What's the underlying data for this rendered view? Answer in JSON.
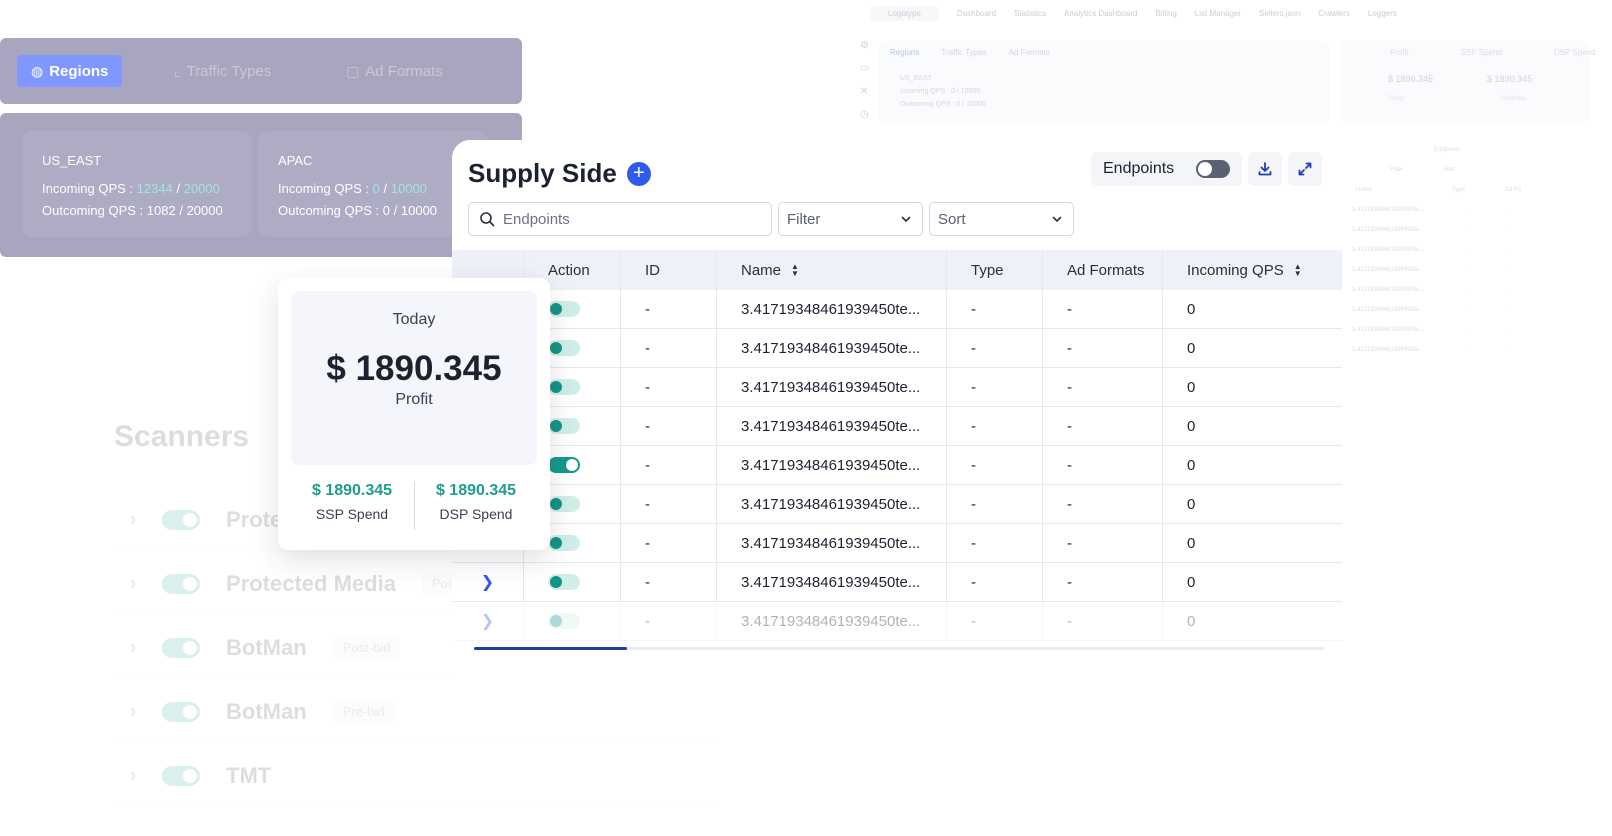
{
  "background_dashboard": {
    "nav": [
      "Logotype",
      "Dashboard",
      "Statistics",
      "Analytics Dashboard",
      "Billing",
      "List Manager",
      "Sellers.json",
      "Crawlers",
      "Loggers"
    ],
    "tabs": [
      "Regions",
      "Traffic Types",
      "Ad Formats"
    ],
    "region": "US_EAST",
    "incoming": "Incoming QPS : 0 / 10000",
    "outcoming": "Outcoming QPS : 0 / 10000",
    "profit_tabs": [
      "Profit",
      "SSP Spend",
      "DSP Spend"
    ],
    "profit_values": [
      "$ 1890.345",
      "$ 1890.345"
    ],
    "profit_sub": [
      "Today",
      "Yesterday"
    ],
    "table_toolbar": {
      "toggle": "Endpoints",
      "filter": "Filter",
      "sort": "Sort"
    },
    "table_headers": [
      "ID",
      "Name",
      "Type",
      "Ad Fo"
    ],
    "table_rows": [
      {
        "id": "-",
        "name": "3.41719348461939450te...",
        "type": "-",
        "ad": "-"
      },
      {
        "id": "-",
        "name": "3.41719348461939450te...",
        "type": "-",
        "ad": "-"
      },
      {
        "id": "-",
        "name": "3.41719348461939450te...",
        "type": "-",
        "ad": "-"
      },
      {
        "id": "-",
        "name": "3.41719348461939450te...",
        "type": "-",
        "ad": "-"
      },
      {
        "id": "-",
        "name": "3.41719348461939450te...",
        "type": "-",
        "ad": "-"
      },
      {
        "id": "-",
        "name": "3.41719348461939450te...",
        "type": "-",
        "ad": "-"
      },
      {
        "id": "-",
        "name": "3.41719348461939450te...",
        "type": "-",
        "ad": "-"
      },
      {
        "id": "-",
        "name": "3.41719348461939450te...",
        "type": "-",
        "ad": "-"
      }
    ]
  },
  "scanners": {
    "title": "Scanners",
    "items": [
      {
        "name": "Prote",
        "tag": ""
      },
      {
        "name": "Protected Media",
        "tag": "Post-b"
      },
      {
        "name": "BotMan",
        "tag": "Post-bid"
      },
      {
        "name": "BotMan",
        "tag": "Pre-bid"
      },
      {
        "name": "TMT",
        "tag": ""
      }
    ]
  },
  "regions": {
    "tabs": [
      "Regions",
      "Traffic Types",
      "Ad Formats"
    ],
    "cards": [
      {
        "name": "US_EAST",
        "incoming_label": "Incoming QPS :",
        "incoming_value": "12344",
        "incoming_max": "20000",
        "outcoming_label": "Outcoming QPS :",
        "outcoming_value": "1082",
        "outcoming_max": "20000"
      },
      {
        "name": "APAC",
        "incoming_label": "Incoming QPS :",
        "incoming_value": "0",
        "incoming_max": "10000",
        "outcoming_label": "Outcoming QPS :",
        "outcoming_value": "0",
        "outcoming_max": "10000"
      }
    ]
  },
  "profit": {
    "period": "Today",
    "amount": "$ 1890.345",
    "label": "Profit",
    "ssp_value": "$ 1890.345",
    "ssp_label": "SSP Spend",
    "dsp_value": "$ 1890.345",
    "dsp_label": "DSP Spend"
  },
  "supply": {
    "title": "Supply Side",
    "add_icon": "plus-icon",
    "endpoints_toggle_label": "Endpoints",
    "endpoints_toggle_on": false,
    "download_icon": "download-icon",
    "expand_icon": "expand-icon",
    "search_placeholder": "Endpoints",
    "filter_label": "Filter",
    "sort_label": "Sort",
    "columns": [
      "",
      "Action",
      "ID",
      "Name",
      "Type",
      "Ad Formats",
      "Incoming QPS"
    ],
    "rows": [
      {
        "action_on": false,
        "id": "-",
        "name": "3.41719348461939450te...",
        "type": "-",
        "ad_formats": "-",
        "incoming_qps": "0",
        "expand": false
      },
      {
        "action_on": false,
        "id": "-",
        "name": "3.41719348461939450te...",
        "type": "-",
        "ad_formats": "-",
        "incoming_qps": "0",
        "expand": false
      },
      {
        "action_on": false,
        "id": "-",
        "name": "3.41719348461939450te...",
        "type": "-",
        "ad_formats": "-",
        "incoming_qps": "0",
        "expand": false
      },
      {
        "action_on": false,
        "id": "-",
        "name": "3.41719348461939450te...",
        "type": "-",
        "ad_formats": "-",
        "incoming_qps": "0",
        "expand": false
      },
      {
        "action_on": true,
        "id": "-",
        "name": "3.41719348461939450te...",
        "type": "-",
        "ad_formats": "-",
        "incoming_qps": "0",
        "expand": false
      },
      {
        "action_on": false,
        "id": "-",
        "name": "3.41719348461939450te...",
        "type": "-",
        "ad_formats": "-",
        "incoming_qps": "0",
        "expand": false
      },
      {
        "action_on": false,
        "id": "-",
        "name": "3.41719348461939450te...",
        "type": "-",
        "ad_formats": "-",
        "incoming_qps": "0",
        "expand": false
      },
      {
        "action_on": false,
        "id": "-",
        "name": "3.41719348461939450te...",
        "type": "-",
        "ad_formats": "-",
        "incoming_qps": "0",
        "expand": true
      },
      {
        "action_on": false,
        "id": "-",
        "name": "3.41719348461939450te...",
        "type": "-",
        "ad_formats": "-",
        "incoming_qps": "0",
        "expand": true
      }
    ],
    "horizontal_scroll_position": 0.18,
    "colors": {
      "accent": "#2f5bea",
      "toggle": "#14988a",
      "region_panel": "#a8a6bf",
      "region_tab_active": "#7f97ff",
      "spend": "#1e9d8d"
    }
  }
}
